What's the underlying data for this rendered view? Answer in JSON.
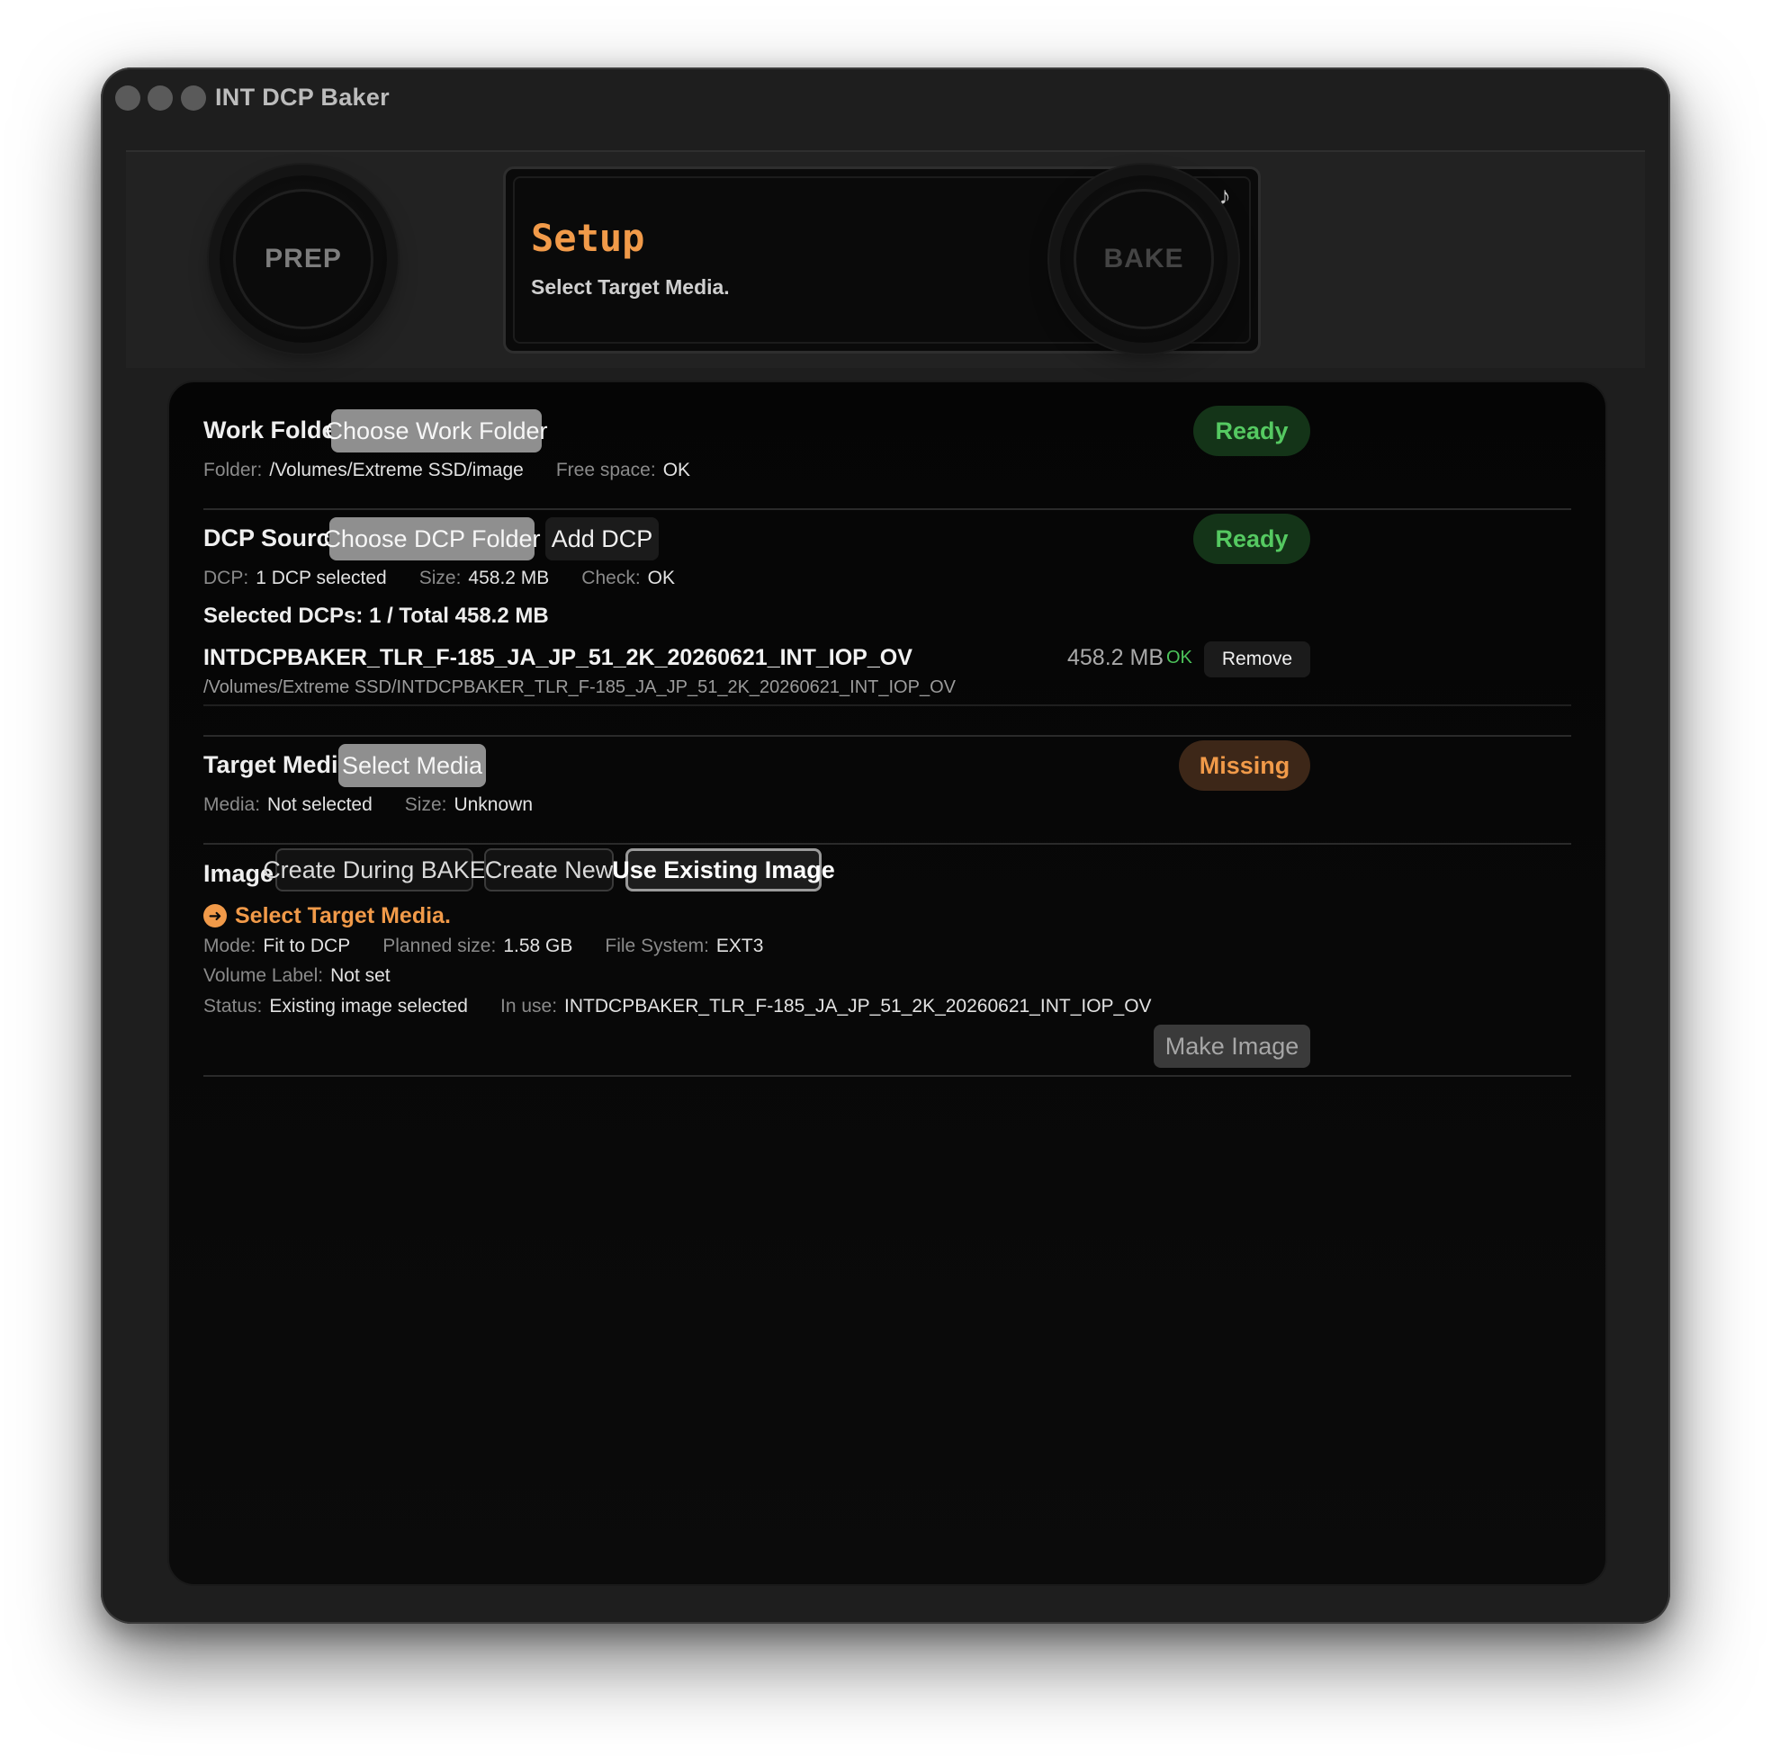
{
  "window": {
    "title": "INT DCP Baker"
  },
  "header": {
    "prep_label": "PREP",
    "bake_label": "BAKE",
    "lcd_title": "Setup",
    "lcd_subtitle": "Select Target Media.",
    "lcd_icon": "music-note-icon"
  },
  "work_folder": {
    "title": "Work Folder",
    "button": "Choose Work Folder",
    "status": "Ready",
    "folder_key": "Folder:",
    "folder_value": "/Volumes/Extreme SSD/image",
    "free_key": "Free space:",
    "free_value": "OK"
  },
  "dcp_source": {
    "title": "DCP Source",
    "choose_button": "Choose DCP Folder",
    "add_button": "Add DCP",
    "status": "Ready",
    "dcp_key": "DCP:",
    "dcp_value": "1 DCP selected",
    "size_key": "Size:",
    "size_value": "458.2 MB",
    "check_key": "Check:",
    "check_value": "OK",
    "summary": "Selected DCPs: 1 / Total 458.2 MB",
    "items": [
      {
        "name": "INTDCPBAKER_TLR_F-185_JA_JP_51_2K_20260621_INT_IOP_OV",
        "path": "/Volumes/Extreme SSD/INTDCPBAKER_TLR_F-185_JA_JP_51_2K_20260621_INT_IOP_OV",
        "size": "458.2 MB",
        "check": "OK",
        "remove_label": "Remove"
      }
    ]
  },
  "target_media": {
    "title": "Target Media",
    "button": "Select Media",
    "status": "Missing",
    "media_key": "Media:",
    "media_value": "Not selected",
    "size_key": "Size:",
    "size_value": "Unknown"
  },
  "image": {
    "title": "Image",
    "options": [
      "Create During BAKE",
      "Create New",
      "Use Existing Image"
    ],
    "selected_option": "Use Existing Image",
    "warning": "Select Target Media.",
    "mode_key": "Mode:",
    "mode_value": "Fit to DCP",
    "planned_key": "Planned size:",
    "planned_value": "1.58 GB",
    "fs_key": "File System:",
    "fs_value": "EXT3",
    "label_key": "Volume Label:",
    "label_value": "Not set",
    "status_key": "Status:",
    "status_value": "Existing image selected",
    "inuse_key": "In use:",
    "inuse_value": "INTDCPBAKER_TLR_F-185_JA_JP_51_2K_20260621_INT_IOP_OV",
    "make_button": "Make Image"
  },
  "colors": {
    "accent": "#f19a49",
    "ready": "#55c961",
    "ok": "#4cc35a"
  }
}
